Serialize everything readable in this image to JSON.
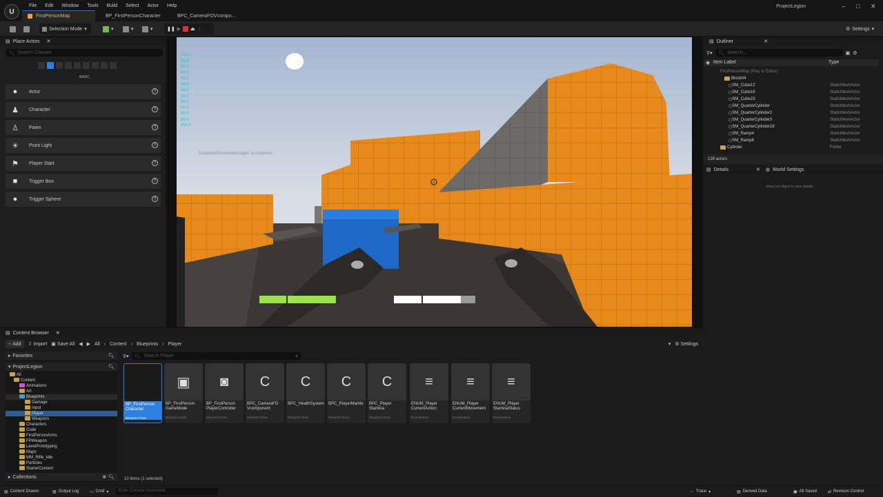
{
  "app": {
    "logo_text": "U",
    "project_name": "ProjectLegion"
  },
  "menu": [
    "File",
    "Edit",
    "Window",
    "Tools",
    "Build",
    "Select",
    "Actor",
    "Help"
  ],
  "tabs": [
    {
      "label": "FirstPersonMap"
    },
    {
      "label": "BP_FirstPersonCharacter"
    },
    {
      "label": "BPC_CameraFOVcompo..."
    }
  ],
  "window_controls": {
    "minimize": "–",
    "maximize": "□",
    "close": "✕"
  },
  "toolbar": {
    "selection_mode": "Selection Mode",
    "settings": "Settings"
  },
  "place_actors": {
    "title": "Place Actors",
    "search_placeholder": "Search Classes",
    "category": "BASIC",
    "items": [
      {
        "label": "Actor",
        "icon": "●"
      },
      {
        "label": "Character",
        "icon": "♟"
      },
      {
        "label": "Pawn",
        "icon": "♙"
      },
      {
        "label": "Point Light",
        "icon": "☀"
      },
      {
        "label": "Player Start",
        "icon": "⚑"
      },
      {
        "label": "Trigger Box",
        "icon": "■"
      },
      {
        "label": "Trigger Sphere",
        "icon": "●"
      }
    ],
    "help_glyph": "?"
  },
  "viewport": {
    "stats": [
      "250.0",
      "99.0",
      "90.0",
      "91.0",
      "93.0",
      "99.0",
      "94.0",
      "95.0",
      "96.0",
      "97.0",
      "98.0",
      "99.0",
      "450.0"
    ],
    "debug_message": "DisableAllScreenMessages' to suppress",
    "health_fill": 0.94,
    "stamina_fill": 0.82,
    "colors": {
      "wall": "#e88a1e",
      "cube": "#1e68c8",
      "health": "#9be34a",
      "stamina": "#ffffff"
    }
  },
  "outliner": {
    "title": "Outliner",
    "search_placeholder": "Search...",
    "col_label": "Item Label",
    "col_type": "Type",
    "rows": [
      {
        "label": "FirstPersonMap (Play In Editor)",
        "type": "",
        "indent": 1
      },
      {
        "label": "Block04",
        "type": "",
        "indent": 2
      },
      {
        "label": "SM_Cube12",
        "type": "StaticMeshActor",
        "indent": 3
      },
      {
        "label": "SM_Cube18",
        "type": "StaticMeshActor",
        "indent": 3
      },
      {
        "label": "SM_Cube23",
        "type": "StaticMeshActor",
        "indent": 3
      },
      {
        "label": "SM_QuarterCylinder",
        "type": "StaticMeshActor",
        "indent": 3
      },
      {
        "label": "SM_QuarterCylinder2",
        "type": "StaticMeshActor",
        "indent": 3
      },
      {
        "label": "SM_QuarterCylinder3",
        "type": "StaticMeshActor",
        "indent": 3
      },
      {
        "label": "SM_QuarterCylinder18",
        "type": "StaticMeshActor",
        "indent": 3
      },
      {
        "label": "SM_Ramp4",
        "type": "StaticMeshActor",
        "indent": 3
      },
      {
        "label": "SM_Ramp8",
        "type": "StaticMeshActor",
        "indent": 3
      },
      {
        "label": "Cylinder",
        "type": "Folder",
        "indent": 2
      }
    ],
    "count": "139 actors"
  },
  "details": {
    "tab": "Details",
    "world_tab": "World Settings",
    "empty_msg": "Select an object to view details."
  },
  "content_browser": {
    "title": "Content Browser",
    "add": "Add",
    "import": "Import",
    "save_all": "Save All",
    "settings": "Settings",
    "breadcrumb": [
      "All",
      "Content",
      "Blueprints",
      "Player"
    ],
    "favorites": "Favorites",
    "project": "ProjectLegion",
    "collections": "Collections",
    "search_placeholder": "Search Player",
    "tree": [
      {
        "label": "All",
        "indent": 0
      },
      {
        "label": "Content",
        "indent": 1
      },
      {
        "label": "Animations",
        "indent": 2
      },
      {
        "label": "Art",
        "indent": 2
      },
      {
        "label": "Blueprints",
        "indent": 2
      },
      {
        "label": "Damage",
        "indent": 3
      },
      {
        "label": "Input",
        "indent": 3
      },
      {
        "label": "Player",
        "indent": 3
      },
      {
        "label": "Weapons",
        "indent": 3
      },
      {
        "label": "Characters",
        "indent": 2
      },
      {
        "label": "Code",
        "indent": 2
      },
      {
        "label": "FirstPersonArms",
        "indent": 2
      },
      {
        "label": "FPWeapon",
        "indent": 2
      },
      {
        "label": "LevelPrototyping",
        "indent": 2
      },
      {
        "label": "Maps",
        "indent": 2
      },
      {
        "label": "MM_Rifle_Idle",
        "indent": 2
      },
      {
        "label": "Particles",
        "indent": 2
      },
      {
        "label": "StarterContent",
        "indent": 2
      }
    ],
    "assets": [
      {
        "name": "BP_FirstPerson Character",
        "type": "Blueprint Class",
        "icon": "",
        "selected": true
      },
      {
        "name": "BP_FirstPerson GameMode",
        "type": "Blueprint Class",
        "icon": "▣",
        "selected": false
      },
      {
        "name": "BP_FirstPerson PlayerController",
        "type": "Blueprint Class",
        "icon": "◙",
        "selected": false
      },
      {
        "name": "BPC_CameraFO Vcomponent",
        "type": "Blueprint Class",
        "icon": "C",
        "selected": false
      },
      {
        "name": "BPC_HealthSystem",
        "type": "Blueprint Class",
        "icon": "C",
        "selected": false
      },
      {
        "name": "BPC_PlayerMantle",
        "type": "Blueprint Class",
        "icon": "C",
        "selected": false
      },
      {
        "name": "BPC_Player Stamina",
        "type": "Blueprint Class",
        "icon": "C",
        "selected": false
      },
      {
        "name": "ENUM_Player CurrentAction",
        "type": "Enumeration",
        "icon": "≡",
        "selected": false
      },
      {
        "name": "ENUM_Player CurrentMovement",
        "type": "Enumeration",
        "icon": "≡",
        "selected": false
      },
      {
        "name": "ENUM_Player StaminaStatus",
        "type": "Enumeration",
        "icon": "≡",
        "selected": false
      }
    ],
    "item_count": "10 items (1 selected)"
  },
  "statusbar": {
    "content_drawer": "Content Drawer",
    "output_log": "Output Log",
    "cmd": "Cmd",
    "console_placeholder": "Enter Console Command",
    "trace": "Trace",
    "derived_data": "Derived Data",
    "all_saved": "All Saved",
    "revision_control": "Revision Control"
  }
}
